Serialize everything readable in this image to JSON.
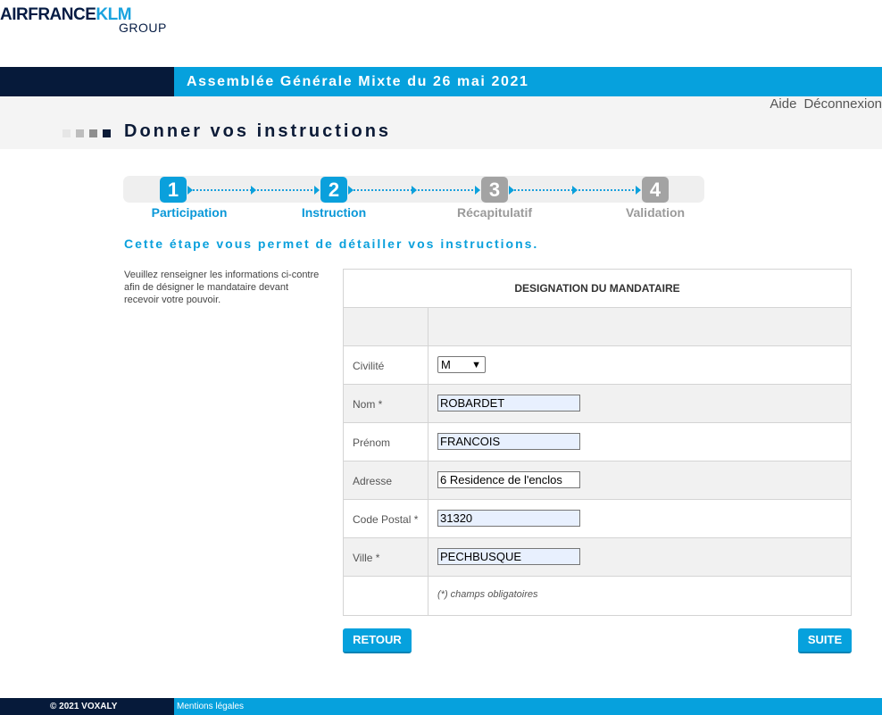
{
  "header": {
    "logo_part1": "AIRFRANCE",
    "logo_part2": "KLM",
    "logo_line2": "GROUP",
    "banner_title": "Assemblée Générale Mixte du 26 mai 2021",
    "help_link": "Aide",
    "logout_link": "Déconnexion",
    "page_title": "Donner vos instructions"
  },
  "steps": [
    {
      "number": "1",
      "label": "Participation",
      "state": "active"
    },
    {
      "number": "2",
      "label": "Instruction",
      "state": "active"
    },
    {
      "number": "3",
      "label": "Récapitulatif",
      "state": "inactive"
    },
    {
      "number": "4",
      "label": "Validation",
      "state": "inactive"
    }
  ],
  "intro": "Cette étape vous permet de détailler vos instructions.",
  "help_text": "Veuillez renseigner les informations ci-contre afin de désigner le mandataire devant recevoir votre pouvoir.",
  "form": {
    "title": "DESIGNATION DU MANDATAIRE",
    "civilite": {
      "label": "Civilité",
      "value": "M"
    },
    "nom": {
      "label": "Nom *",
      "value": "ROBARDET"
    },
    "prenom": {
      "label": "Prénom",
      "value": "FRANCOIS"
    },
    "adresse": {
      "label": "Adresse",
      "value": "6 Residence de l'enclos"
    },
    "code_postal": {
      "label": "Code Postal *",
      "value": "31320"
    },
    "ville": {
      "label": "Ville *",
      "value": "PECHBUSQUE"
    },
    "required_note": "(*) champs obligatoires"
  },
  "buttons": {
    "back": "RETOUR",
    "next": "SUITE"
  },
  "footer": {
    "copyright": "© 2021 VOXALY",
    "legal": "Mentions légales"
  },
  "colors": {
    "brand_blue": "#06a1dd",
    "navy": "#061a3a",
    "step_inactive": "#a3a3a3"
  }
}
